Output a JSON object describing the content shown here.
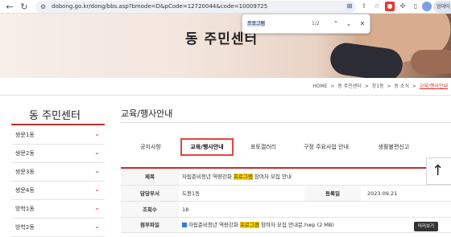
{
  "browser": {
    "url": "dobong.go.kr/dong/bbs.asp?bmode=D&pCode=12720044&code=10009725",
    "avatar_label": "업데이"
  },
  "banner": {
    "title": "동 주민센터"
  },
  "find": {
    "query": "프로그램",
    "count": "1/2"
  },
  "breadcrumb": [
    "HOME",
    ">",
    "동 주민센터",
    ">",
    "창1동",
    ">",
    "동 소식",
    ">",
    "교육/행사안내"
  ],
  "sidebar": {
    "title": "동 주민센터",
    "items": [
      "쌍문1동",
      "쌍문2동",
      "쌍문3동",
      "쌍문4동",
      "방학1동",
      "방학2동"
    ]
  },
  "main": {
    "title": "교육/행사안내",
    "tabs": [
      "공지사항",
      "교육/행사안내",
      "포토갤러리",
      "구정 주요사업 안내",
      "생활불편신고"
    ],
    "rows": {
      "subject_label": "제목",
      "subject_pre": "자립준비청년 역량강화 ",
      "subject_hl": "프로그램",
      "subject_post": " 참여자 모집 안내",
      "dept_label": "담당부서",
      "dept_value": "도봉1동",
      "date_label": "등록일",
      "date_value": "2023.09.21",
      "views_label": "조회수",
      "views_value": "18",
      "file_label": "첨부파일",
      "file_pre": "자립준비청년 역량강화 ",
      "file_hl": "프로그램",
      "file_post": " 참여자 모집 안내문.hwp (2 MB)"
    },
    "preview_label": "미리보기"
  }
}
